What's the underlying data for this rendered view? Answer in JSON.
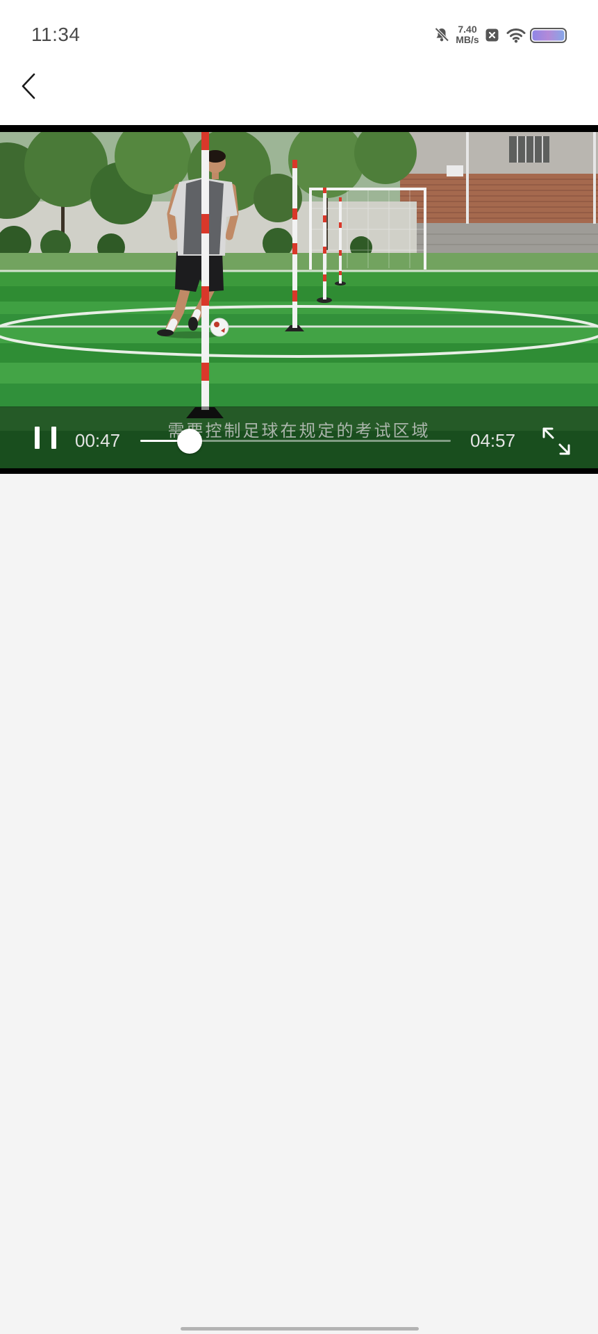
{
  "status_bar": {
    "time": "11:34",
    "net_speed": {
      "value": "7.40",
      "unit": "MB/s"
    },
    "icons": [
      "bell-off-icon",
      "x-box-icon",
      "wifi-icon",
      "battery-icon"
    ]
  },
  "header": {
    "back_icon": "chevron-left-icon"
  },
  "video_player": {
    "subtitle": "需要控制足球在规定的考试区域",
    "current_time": "00:47",
    "duration": "04:57",
    "progress": 0.158,
    "play_pause_icon": "pause-icon",
    "fullscreen_icon": "fullscreen-icon"
  },
  "colors": {
    "app_background": "#ffffff",
    "content_background": "#f4f4f4",
    "player_background": "#000000",
    "progress_played": "#ffffff",
    "progress_remaining": "rgba(255,255,255,0.45)"
  }
}
